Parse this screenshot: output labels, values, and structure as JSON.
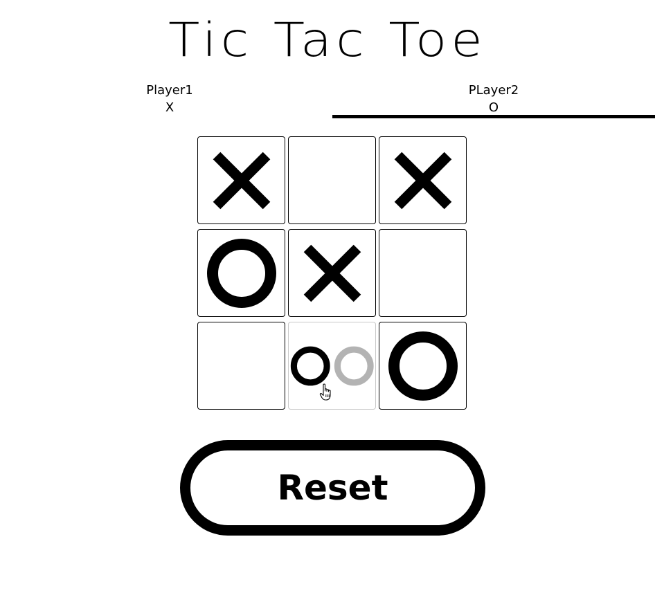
{
  "title": "Tic Tac Toe",
  "players": [
    {
      "name": "Player1",
      "symbol": "X",
      "active": false
    },
    {
      "name": "PLayer2",
      "symbol": "O",
      "active": true
    }
  ],
  "board": {
    "cells": [
      "X",
      "",
      "X",
      "O",
      "X",
      "",
      "",
      "O",
      "O"
    ],
    "hover_preview": {
      "index": 7,
      "symbol": "O",
      "color": "#b3b3b3"
    }
  },
  "reset_label": "Reset",
  "colors": {
    "mark": "#000000",
    "preview": "#b3b3b3",
    "background": "#ffffff"
  }
}
